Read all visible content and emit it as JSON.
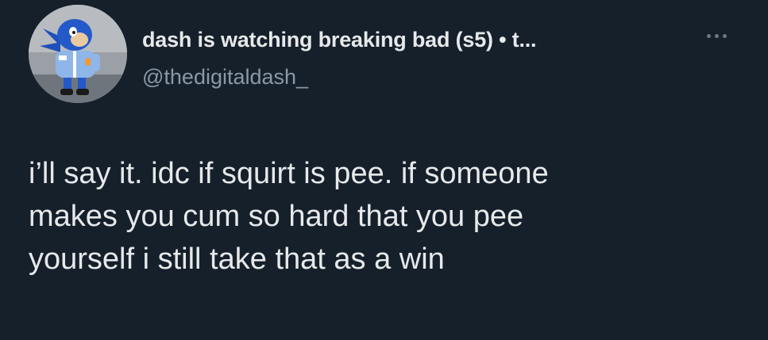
{
  "tweet": {
    "author": {
      "display_name": "dash is watching breaking bad (s5) • t...",
      "handle": "@thedigitaldash_",
      "avatar_icon": "sonic-character-avatar"
    },
    "more_icon": "ellipsis-icon",
    "text_lines": [
      "i’ll say it. idc if squirt is pee. if someone",
      "makes you cum so hard that you pee",
      "yourself i still take that as a win"
    ]
  },
  "colors": {
    "background": "#15202b",
    "primary_text": "#e7e9ea",
    "secondary_text": "#8b98a5"
  }
}
